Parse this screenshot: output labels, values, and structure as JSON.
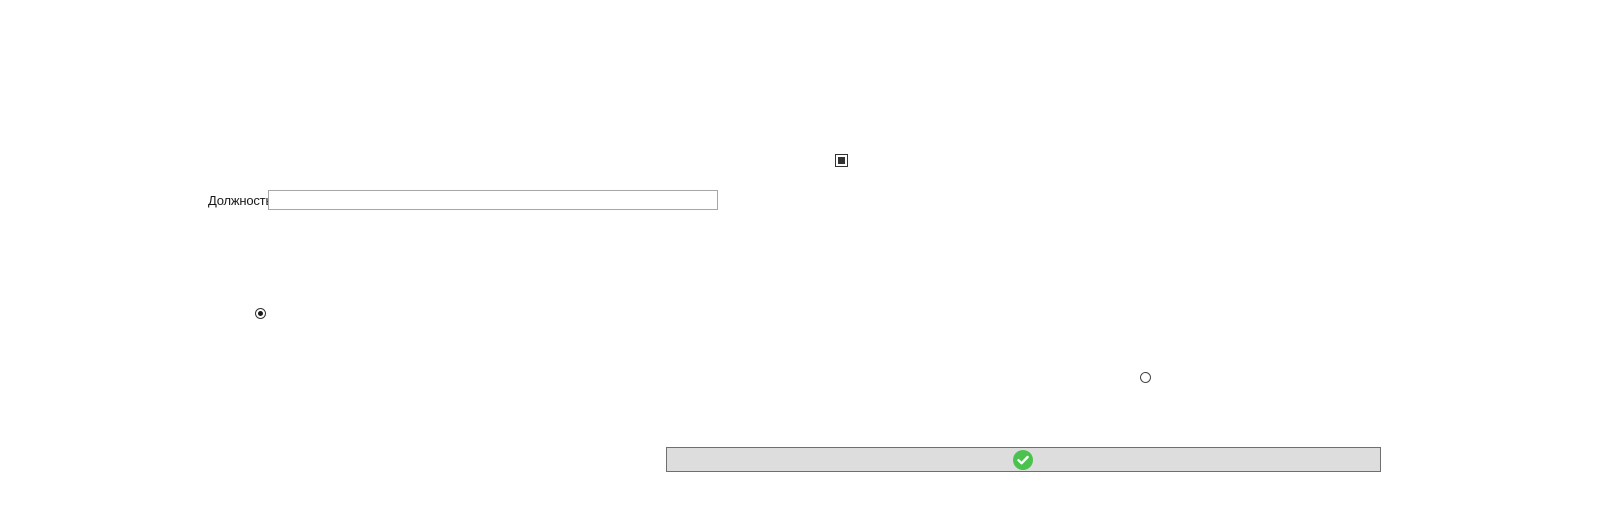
{
  "form": {
    "position_label": "Должность",
    "position_value": "",
    "position_placeholder": ""
  },
  "checkbox": {
    "checked": true
  },
  "radios": [
    {
      "selected": true
    },
    {
      "selected": false
    }
  ],
  "ok_button": {
    "icon": "check-circle-icon",
    "icon_color": "#4cc24e"
  }
}
